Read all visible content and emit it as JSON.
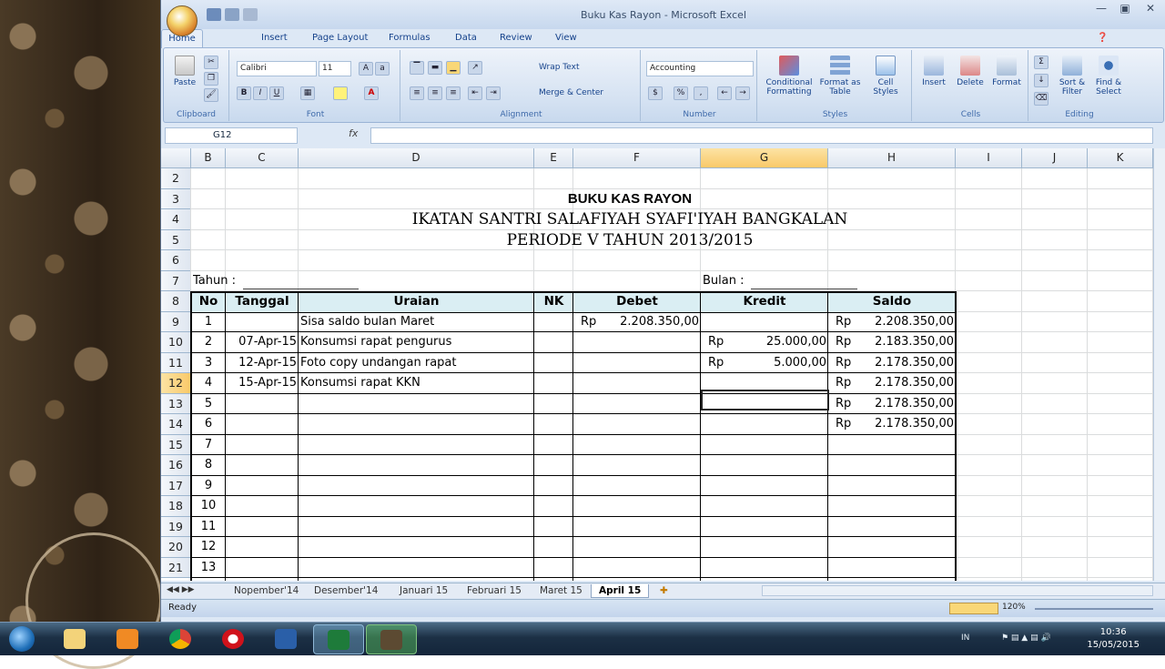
{
  "window": {
    "title": "Buku Kas Rayon - Microsoft Excel"
  },
  "ribbon_tabs": [
    "Home",
    "Insert",
    "Page Layout",
    "Formulas",
    "Data",
    "Review",
    "View"
  ],
  "ribbon": {
    "clipboard": {
      "label": "Clipboard",
      "paste": "Paste"
    },
    "font": {
      "label": "Font",
      "name": "Calibri",
      "size": "11",
      "bold": "B",
      "italic": "I",
      "underline": "U"
    },
    "alignment": {
      "label": "Alignment",
      "wrap": "Wrap Text",
      "merge": "Merge & Center"
    },
    "number": {
      "label": "Number",
      "format": "Accounting",
      "percent": "%",
      "comma": ","
    },
    "styles": {
      "label": "Styles",
      "conditional": "Conditional Formatting",
      "format_table": "Format as Table",
      "cell_styles": "Cell Styles"
    },
    "cells": {
      "label": "Cells",
      "insert": "Insert",
      "delete": "Delete",
      "format": "Format"
    },
    "editing": {
      "label": "Editing",
      "sort": "Sort & Filter",
      "find": "Find & Select",
      "sigma": "Σ"
    }
  },
  "formula_bar": {
    "name_box": "G12",
    "fx": "fx",
    "value": ""
  },
  "columns": [
    "B",
    "C",
    "D",
    "E",
    "F",
    "G",
    "H",
    "I",
    "J",
    "K"
  ],
  "rows": [
    "2",
    "3",
    "4",
    "5",
    "6",
    "7",
    "8",
    "9",
    "10",
    "11",
    "12",
    "13",
    "14",
    "15",
    "16",
    "17",
    "18",
    "19",
    "20",
    "21"
  ],
  "sheet": {
    "title1": "BUKU KAS RAYON",
    "title2": "IKATAN SANTRI SALAFIYAH SYAFI'IYAH BANGKALAN",
    "title3": "PERIODE V TAHUN 2013/2015",
    "tahun": "Tahun :",
    "bulan": "Bulan :",
    "headers": {
      "no": "No",
      "tanggal": "Tanggal",
      "uraian": "Uraian",
      "nk": "NK",
      "debet": "Debet",
      "kredit": "Kredit",
      "saldo": "Saldo"
    },
    "currency": "Rp",
    "entries": [
      {
        "no": "1",
        "tanggal": "",
        "uraian": "Sisa saldo bulan Maret",
        "debet": "2.208.350,00",
        "kredit": "",
        "saldo": "2.208.350,00"
      },
      {
        "no": "2",
        "tanggal": "07-Apr-15",
        "uraian": "Konsumsi rapat pengurus",
        "debet": "",
        "kredit": "25.000,00",
        "saldo": "2.183.350,00"
      },
      {
        "no": "3",
        "tanggal": "12-Apr-15",
        "uraian": "Foto copy undangan rapat",
        "debet": "",
        "kredit": "5.000,00",
        "saldo": "2.178.350,00"
      },
      {
        "no": "4",
        "tanggal": "15-Apr-15",
        "uraian": "Konsumsi rapat KKN",
        "debet": "",
        "kredit": "",
        "saldo": "2.178.350,00"
      },
      {
        "no": "5",
        "tanggal": "",
        "uraian": "",
        "debet": "",
        "kredit": "",
        "saldo": "2.178.350,00"
      },
      {
        "no": "6",
        "tanggal": "",
        "uraian": "",
        "debet": "",
        "kredit": "",
        "saldo": "2.178.350,00"
      },
      {
        "no": "7"
      },
      {
        "no": "8"
      },
      {
        "no": "9"
      },
      {
        "no": "10"
      },
      {
        "no": "11"
      },
      {
        "no": "12"
      },
      {
        "no": "13"
      }
    ]
  },
  "sheet_tabs": [
    "Nopember'14",
    "Desember'14",
    "Januari 15",
    "Februari 15",
    "Maret 15",
    "April 15"
  ],
  "active_sheet": "April 15",
  "status": {
    "ready": "Ready",
    "zoom": "120%"
  },
  "taskbar": {
    "time": "10:36",
    "date": "15/05/2015",
    "lang": "IN"
  }
}
